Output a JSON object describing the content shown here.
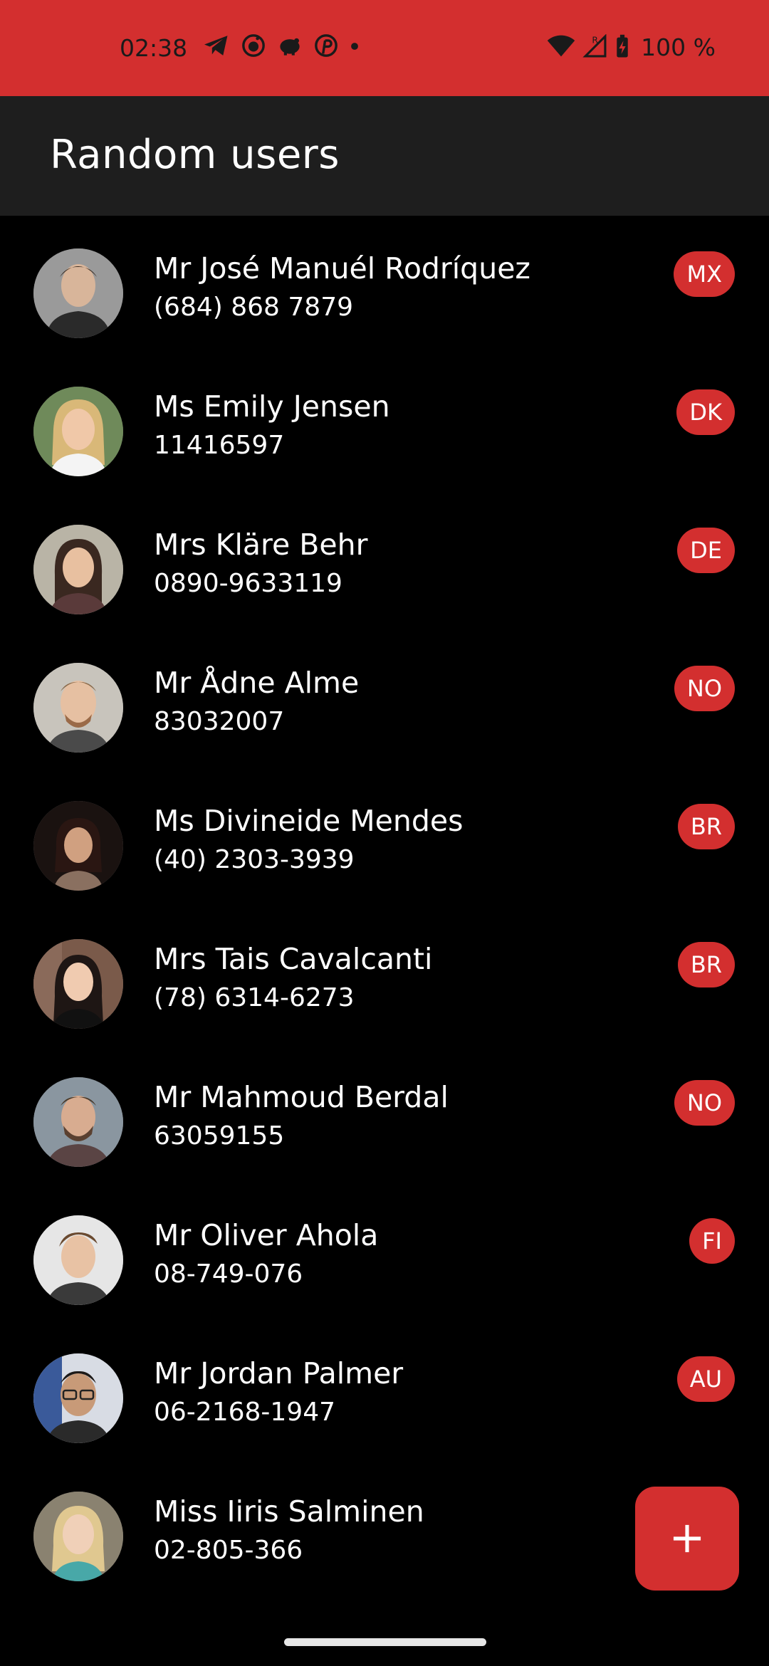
{
  "status_bar": {
    "time": "02:38",
    "battery": "100 %",
    "color": "#d32f2f",
    "icons_left": [
      "telegram-icon",
      "reddit-icon",
      "piggy-bank-icon",
      "pinterest-icon",
      "dot-icon"
    ],
    "icons_right": [
      "wifi-icon",
      "signal-roaming-icon",
      "battery-charging-icon"
    ]
  },
  "app_bar": {
    "title": "Random users"
  },
  "users": [
    {
      "name": "Mr José Manuél Rodríquez",
      "phone": "(684) 868 7879",
      "country": "MX",
      "avatar_color": "#8a7b6e"
    },
    {
      "name": "Ms Emily Jensen",
      "phone": "11416597",
      "country": "DK",
      "avatar_color": "#c9a76a"
    },
    {
      "name": "Mrs Kläre Behr",
      "phone": "0890-9633119",
      "country": "DE",
      "avatar_color": "#6b5648"
    },
    {
      "name": "Mr Ådne Alme",
      "phone": "83032007",
      "country": "NO",
      "avatar_color": "#b89a86"
    },
    {
      "name": "Ms Divineide Mendes",
      "phone": "(40) 2303-3939",
      "country": "BR",
      "avatar_color": "#3a2a24"
    },
    {
      "name": "Mrs Tais Cavalcanti",
      "phone": "(78) 6314-6273",
      "country": "BR",
      "avatar_color": "#5a4a44"
    },
    {
      "name": "Mr Mahmoud Berdal",
      "phone": "63059155",
      "country": "NO",
      "avatar_color": "#7a6a5a"
    },
    {
      "name": "Mr Oliver Ahola",
      "phone": "08-749-076",
      "country": "FI",
      "avatar_color": "#a89888"
    },
    {
      "name": "Mr Jordan Palmer",
      "phone": "06-2168-1947",
      "country": "AU",
      "avatar_color": "#5a6a84"
    },
    {
      "name": "Miss Iiris Salminen",
      "phone": "02-805-366",
      "country": "",
      "avatar_color": "#c8b08a"
    }
  ],
  "fab": {
    "icon": "plus-icon",
    "color": "#d32f2f"
  },
  "accent_color": "#d32f2f"
}
